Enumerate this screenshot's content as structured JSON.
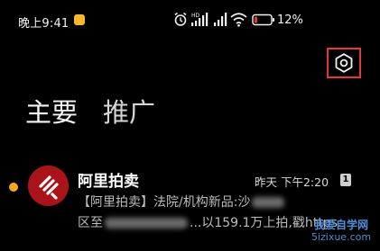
{
  "status_bar": {
    "time": "晚上9:41",
    "battery_percent": "12",
    "battery_suffix": "%"
  },
  "tabs": [
    {
      "label": "主要"
    },
    {
      "label": "推广"
    }
  ],
  "notification": {
    "app_name": "阿里拍卖",
    "timestamp": "昨天 下午2:20",
    "count": "1",
    "line1_a": "【阿里拍卖】法院/机构新品:沙",
    "line1_b": "",
    "line2_a": "区至",
    "line2_b": "...以159.1万上拍,戳https:"
  },
  "watermark": {
    "line1": "我爱自学网",
    "line2": "5izixue.com"
  },
  "colors": {
    "background": "#000000",
    "highlight_box": "#e53935",
    "app_icon": "#d81e06",
    "unread_dot": "#f5a623",
    "notif_status_icon": "#f5b82e",
    "watermark": "#4f8ed6"
  }
}
